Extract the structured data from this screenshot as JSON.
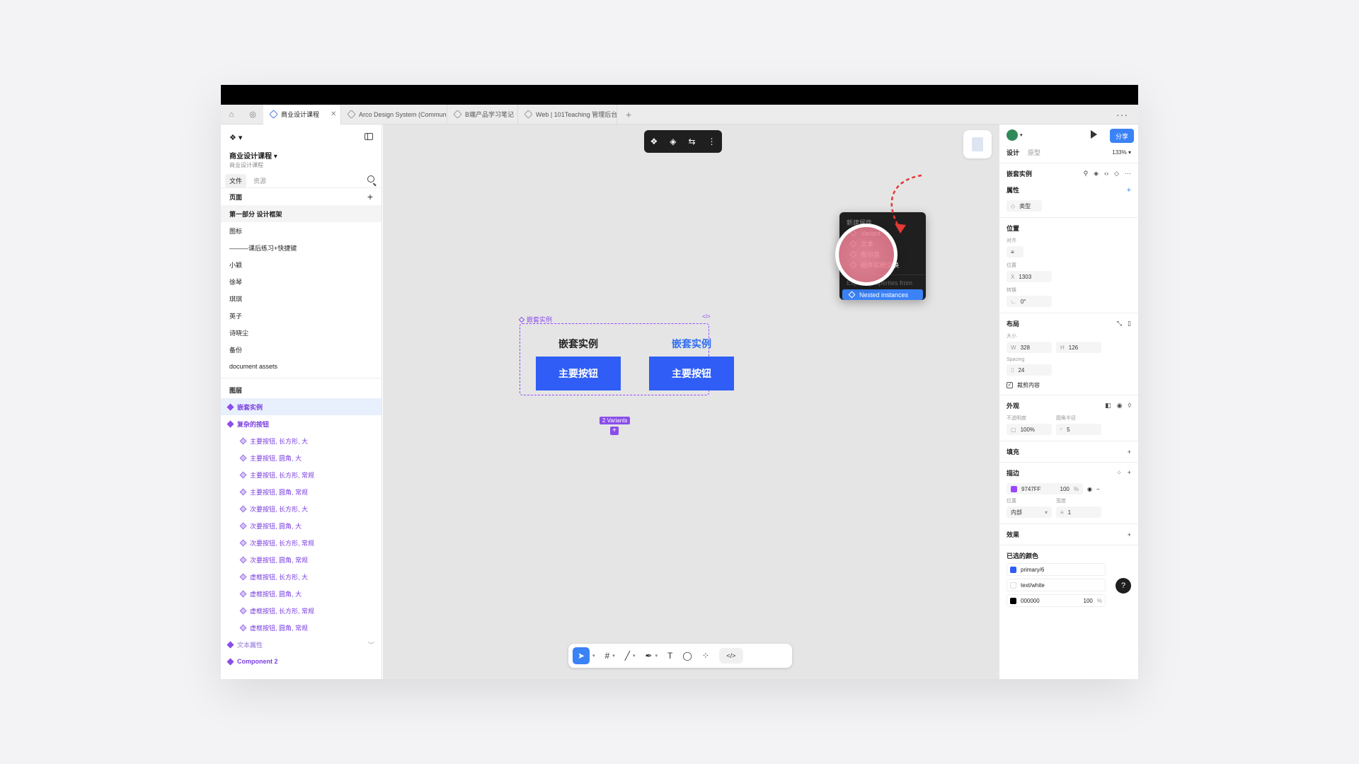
{
  "tabs": [
    {
      "label": "商业设计课程",
      "active": true
    },
    {
      "label": "Arco Design System (Community) (Co"
    },
    {
      "label": "B端产品学习笔记"
    },
    {
      "label": "Web | 101Teaching 管理后台"
    }
  ],
  "left": {
    "project_title": "商业设计课程",
    "project_sub": "商业设计课程",
    "tab_file": "文件",
    "tab_assets": "资源",
    "pages_header": "页面",
    "pages": [
      "第一部分 设计框架",
      "图标",
      "———课后练习+快捷键",
      "小颖",
      "徐琴",
      "琪琪",
      "英子",
      "诗晓尘",
      "备份",
      "document assets"
    ],
    "layers_header": "图层",
    "layers": [
      {
        "label": "嵌套实例",
        "level": 0,
        "selected": true
      },
      {
        "label": "复杂的按钮",
        "level": 0
      },
      {
        "label": "主要按钮, 长方形, 大",
        "level": 1
      },
      {
        "label": "主要按钮, 圆角, 大",
        "level": 1
      },
      {
        "label": "主要按钮, 长方形, 常规",
        "level": 1
      },
      {
        "label": "主要按钮, 圆角, 常规",
        "level": 1
      },
      {
        "label": "次要按钮, 长方形, 大",
        "level": 1
      },
      {
        "label": "次要按钮, 圆角, 大",
        "level": 1
      },
      {
        "label": "次要按钮, 长方形, 常规",
        "level": 1
      },
      {
        "label": "次要按钮, 圆角, 常规",
        "level": 1
      },
      {
        "label": "虚框按钮, 长方形, 大",
        "level": 1
      },
      {
        "label": "虚框按钮, 圆角, 大",
        "level": 1
      },
      {
        "label": "虚框按钮, 长方形, 常规",
        "level": 1
      },
      {
        "label": "虚框按钮, 圆角, 常规",
        "level": 1
      },
      {
        "label": "文本属性",
        "level": 0,
        "dim": true
      },
      {
        "label": "Component 2",
        "level": 0
      }
    ]
  },
  "canvas": {
    "component_label": "嵌套实例",
    "variant1_title": "嵌套实例",
    "variant1_button": "主要按钮",
    "variant2_title": "嵌套实例",
    "variant2_button": "主要按钮",
    "variants_badge": "2 Variants"
  },
  "right": {
    "share": "分享",
    "tab_design": "设计",
    "tab_prototype": "原型",
    "zoom": "133%",
    "component_name": "嵌套实例",
    "properties": "属性",
    "prop_type": "类型",
    "position": "位置",
    "align": "对齐",
    "pos_label": "位置",
    "x_value": "1303",
    "rotate_label": "转换",
    "rotate_value": "0°",
    "layout": "布局",
    "size_label": "大小",
    "w_value": "328",
    "h_value": "126",
    "spacing_label": "Spacing",
    "spacing_value": "24",
    "clip": "裁剪内容",
    "appearance": "外观",
    "opacity_label": "不透明度",
    "opacity_value": "100%",
    "radius_label": "圆角半径",
    "radius_value": "5",
    "fill": "填充",
    "stroke": "描边",
    "stroke_color": "9747FF",
    "stroke_opacity": "100",
    "stroke_pct": "%",
    "stroke_pos_label": "位置",
    "stroke_pos": "内部",
    "stroke_width_label": "宽度",
    "stroke_width": "1",
    "effects": "效果",
    "selected_colors": "已选的颜色",
    "colors": [
      {
        "name": "primary/6",
        "hex": "#2f5df5"
      },
      {
        "name": "text/white",
        "hex": "#ffffff"
      },
      {
        "name": "000000",
        "hex": "#000000",
        "opacity": "100",
        "pct": "%"
      }
    ]
  },
  "popup": {
    "header": "新建属性",
    "items": [
      "Variant",
      "文本",
      "布尔值",
      "组件实例交换"
    ],
    "expose": "Expose properties from",
    "selected": "Nested instances"
  },
  "colors": {
    "accent": "#3b82f6",
    "component": "#9747FF",
    "button": "#2f5df5"
  }
}
